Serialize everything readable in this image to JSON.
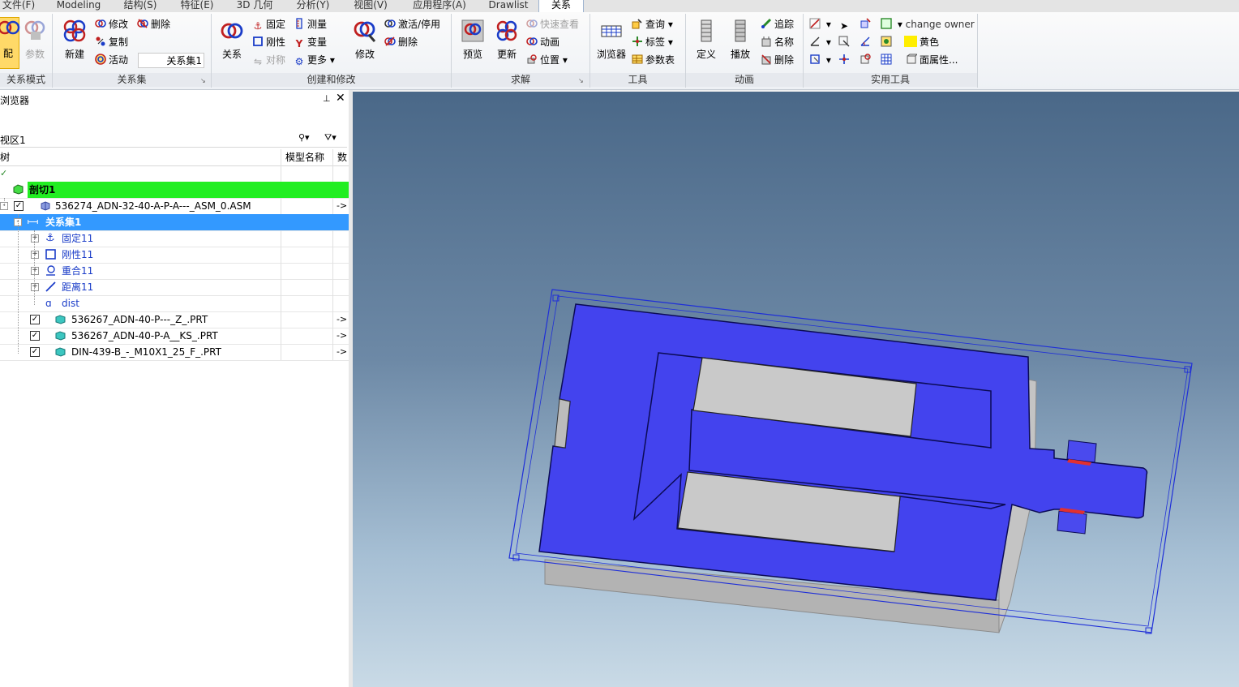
{
  "tabs": [
    {
      "label": "文件(F)"
    },
    {
      "label": "Modeling"
    },
    {
      "label": "结构(S)"
    },
    {
      "label": "特征(E)"
    },
    {
      "label": "3D 几何"
    },
    {
      "label": "分析(Y)"
    },
    {
      "label": "视图(V)"
    },
    {
      "label": "应用程序(A)"
    },
    {
      "label": "Drawlist"
    },
    {
      "label": "关系"
    }
  ],
  "ribbon": {
    "mode": {
      "btn1": "配",
      "btn2": "参数",
      "label": "关系模式"
    },
    "relset": {
      "new": "新建",
      "modify": "修改",
      "delete": "删除",
      "copy": "复制",
      "active": "活动",
      "combo": "关系集1",
      "label": "关系集"
    },
    "create": {
      "relation": "关系",
      "fixed": "固定",
      "rigid": "刚性",
      "symmetric": "对称",
      "measure": "测量",
      "variable": "变量",
      "more": "更多",
      "modify": "修改",
      "activate": "激活/停用",
      "delete": "删除",
      "label": "创建和修改"
    },
    "solve": {
      "preview": "预览",
      "update": "更新",
      "quickview": "快速查看",
      "animation": "动画",
      "position": "位置",
      "label": "求解"
    },
    "tools": {
      "browser": "浏览器",
      "query": "查询",
      "tag": "标签",
      "paramtable": "参数表",
      "label": "工具"
    },
    "anim": {
      "define": "定义",
      "play": "播放",
      "track": "追踪",
      "name": "名称",
      "delete": "删除",
      "label": "动画"
    },
    "util": {
      "change_owner": "change owner",
      "yellow": "黄色",
      "face_attr": "面属性...",
      "label": "实用工具"
    },
    "colors": {
      "yellow": "#ffee00"
    }
  },
  "browser": {
    "title": "浏览器",
    "view": "视区1",
    "col_tree": "树",
    "col_model": "模型名称",
    "col_count": "数",
    "rows": [
      {
        "label": "剖切1"
      },
      {
        "label": "536274_ADN-32-40-A-P-A---_ASM_0.ASM",
        "arrow": "->"
      },
      {
        "label": "关系集1"
      },
      {
        "label": "固定11"
      },
      {
        "label": "刚性11"
      },
      {
        "label": "重合11"
      },
      {
        "label": "距离11"
      },
      {
        "label": "dist"
      },
      {
        "label": "536267_ADN-40-P---_Z_.PRT",
        "arrow": "->"
      },
      {
        "label": "536267_ADN-40-P-A__KS_.PRT",
        "arrow": "->"
      },
      {
        "label": "DIN-439-B_-_M10X1_25_F_.PRT",
        "arrow": "->"
      }
    ]
  }
}
